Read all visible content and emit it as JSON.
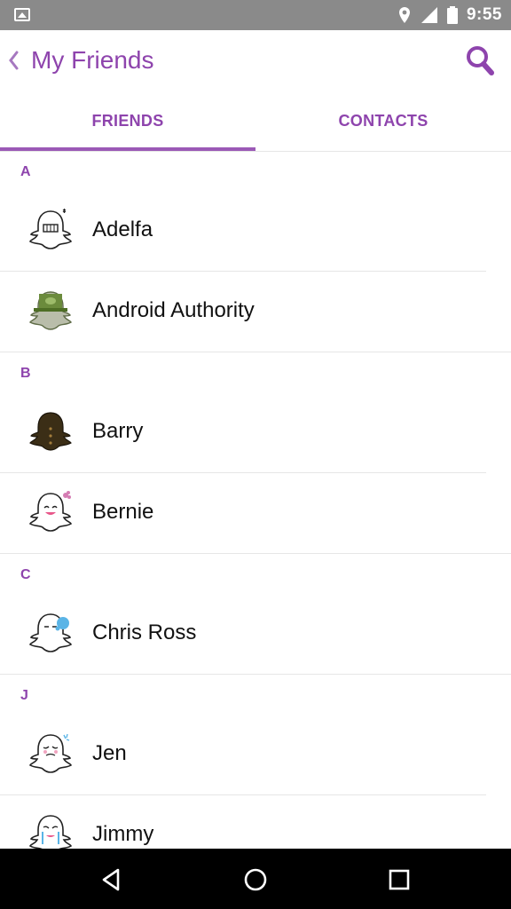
{
  "status_bar": {
    "time": "9:55"
  },
  "header": {
    "title": "My Friends"
  },
  "tabs": {
    "friends": "FRIENDS",
    "contacts": "CONTACTS"
  },
  "sections": [
    {
      "letter": "A",
      "friends": [
        "Adelfa",
        "Android Authority"
      ]
    },
    {
      "letter": "B",
      "friends": [
        "Barry",
        "Bernie"
      ]
    },
    {
      "letter": "C",
      "friends": [
        "Chris Ross"
      ]
    },
    {
      "letter": "J",
      "friends": [
        "Jen",
        "Jimmy"
      ]
    }
  ],
  "colors": {
    "accent": "#8e44ad",
    "status_bar": "#8a8a8a"
  },
  "icons": {
    "back": "chevron-left-icon",
    "search": "search-icon",
    "nav_back": "triangle-back-icon",
    "nav_home": "circle-home-icon",
    "nav_recents": "square-recents-icon"
  }
}
